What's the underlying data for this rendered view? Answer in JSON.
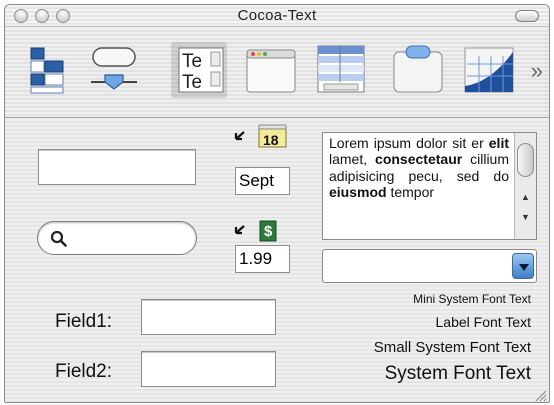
{
  "window": {
    "title": "Cocoa-Text"
  },
  "toolbar": {
    "items": [
      {
        "icon": "outline-view-icon"
      },
      {
        "icon": "buttons-icon"
      },
      {
        "icon": "text-fields-icon",
        "line1": "Te",
        "line2": "Te"
      },
      {
        "icon": "window-icon"
      },
      {
        "icon": "table-view-icon"
      },
      {
        "icon": "tab-view-icon"
      },
      {
        "icon": "graph-icon"
      }
    ],
    "overflow_symbol": "»"
  },
  "fields": {
    "text_field_value": "",
    "search_placeholder": "",
    "field1_label": "Field1:",
    "field1_value": "",
    "field2_label": "Field2:",
    "field2_value": ""
  },
  "date_stepper": {
    "calendar_day": "18",
    "value": "Sept"
  },
  "currency_stepper": {
    "symbol": "$",
    "value": "1.99"
  },
  "text_view": {
    "html": "Lorem ipsum dolor sit er <b>elit</b> lamet, <b>consectetaur</b> cillium adipisicing pecu, sed do <b>eiusmod</b> tempor"
  },
  "popup": {
    "selected": ""
  },
  "font_labels": {
    "mini": "Mini System Font Text",
    "label": "Label Font Text",
    "small": "Small System Font Text",
    "system": "System Font Text"
  }
}
